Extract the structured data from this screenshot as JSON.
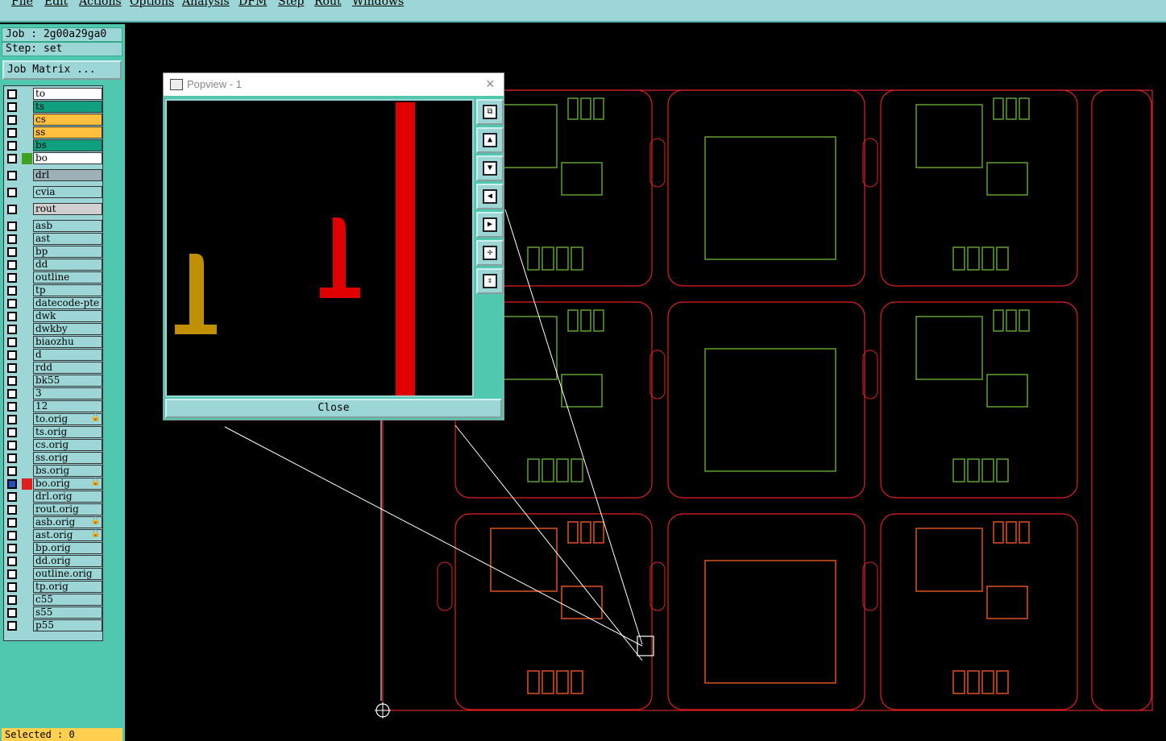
{
  "menu": [
    "File",
    "Edit",
    "Actions",
    "Options",
    "Analysis",
    "DFM",
    "Step",
    "Rout",
    "Windows"
  ],
  "job_label": "Job : 2g00a29ga0",
  "step_label": "Step: set",
  "job_matrix_button": "Job Matrix ...",
  "layers": [
    {
      "name": "to",
      "color": "#ffffff",
      "bg": "#ffffff"
    },
    {
      "name": "ts",
      "color": "#10a080",
      "bg": "#10a080"
    },
    {
      "name": "cs",
      "color": "#ffc040",
      "bg": "#ffc040"
    },
    {
      "name": "ss",
      "color": "#ffc040",
      "bg": "#ffc040"
    },
    {
      "name": "bs",
      "color": "#10a080",
      "bg": "#10a080"
    },
    {
      "name": "bo",
      "color": "#ffffff",
      "bg": "#ffffff",
      "swatch": "#40a020"
    },
    {
      "name": "drl",
      "color": "#9cb0b8",
      "bg": "#9cb0b8"
    },
    {
      "name": "cvia",
      "color": "#9cd6d6",
      "bg": "#9cd6d6"
    },
    {
      "name": "rout",
      "color": "#d0d0d0",
      "bg": "#d0d0d0"
    },
    {
      "name": "asb"
    },
    {
      "name": "ast"
    },
    {
      "name": "bp"
    },
    {
      "name": "dd"
    },
    {
      "name": "outline"
    },
    {
      "name": "tp"
    },
    {
      "name": "datecode-pte"
    },
    {
      "name": "dwk"
    },
    {
      "name": "dwkby"
    },
    {
      "name": "biaozhu"
    },
    {
      "name": "d"
    },
    {
      "name": "rdd"
    },
    {
      "name": "bk55"
    },
    {
      "name": "3"
    },
    {
      "name": "12"
    },
    {
      "name": "to.orig",
      "lock": "🔒"
    },
    {
      "name": "ts.orig"
    },
    {
      "name": "cs.orig"
    },
    {
      "name": "ss.orig"
    },
    {
      "name": "bs.orig"
    },
    {
      "name": "bo.orig",
      "lock": "🔒",
      "checked": true,
      "swatch": "#e02020"
    },
    {
      "name": "drl.orig"
    },
    {
      "name": "rout.orig"
    },
    {
      "name": "asb.orig",
      "lock": "🔒"
    },
    {
      "name": "ast.orig",
      "lock": "🔒"
    },
    {
      "name": "bp.orig"
    },
    {
      "name": "dd.orig"
    },
    {
      "name": "outline.orig"
    },
    {
      "name": "tp.orig"
    },
    {
      "name": "c55"
    },
    {
      "name": "s55"
    },
    {
      "name": "p55"
    }
  ],
  "selected_label": "Selected : 0",
  "popview": {
    "title": "Popview - 1",
    "close_x": "×",
    "close_button": "Close",
    "tools": [
      "zoom-fit",
      "pan-up",
      "pan-down",
      "pan-left",
      "pan-right",
      "zoom-in",
      "zoom-out"
    ]
  },
  "colors": {
    "panel_bg": "#50c8b0",
    "menu_bg": "#9cd6d6",
    "board_outline": "#e02020",
    "silkscreen": "#60a030",
    "active_silk": "#e05020",
    "popview_bar": "#e00000",
    "popview_glyph_left": "#c09000",
    "popview_glyph_right": "#e00000"
  }
}
